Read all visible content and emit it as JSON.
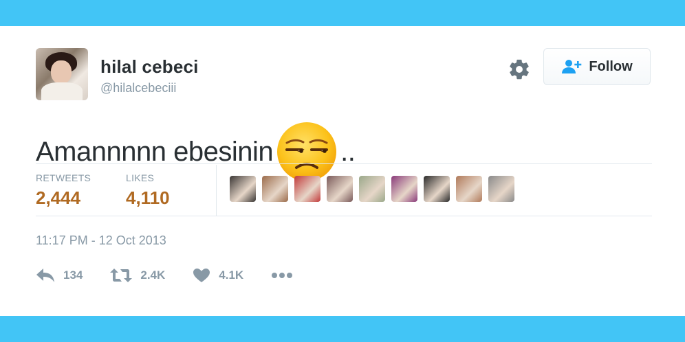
{
  "colors": {
    "band": "#42c5f6",
    "text": "#292f33",
    "muted": "#8899a6",
    "stat": "#b06a22",
    "follow_icon": "#1da1f2"
  },
  "user": {
    "name": "hilal cebeci",
    "handle": "@hilalcebeciii"
  },
  "follow": {
    "label": "Follow",
    "icon": "add-user-icon"
  },
  "tweet": {
    "text_before": "Amannnnn ebesinin",
    "emoji": "unamused-face-emoji",
    "text_after": ".."
  },
  "stats": {
    "retweets_label": "RETWEETS",
    "retweets_value": "2,444",
    "likes_label": "LIKES",
    "likes_value": "4,110"
  },
  "likers": [
    "#3a3634",
    "#9b6b4a",
    "#c23a3a",
    "#7a5a5a",
    "#9aa88a",
    "#8a3a7a",
    "#2a2a2a",
    "#b07a5a",
    "#8a8a8a"
  ],
  "timestamp": "11:17 PM - 12 Oct 2013",
  "actions": {
    "reply_count": "134",
    "retweet_count": "2.4K",
    "like_count": "4.1K"
  }
}
